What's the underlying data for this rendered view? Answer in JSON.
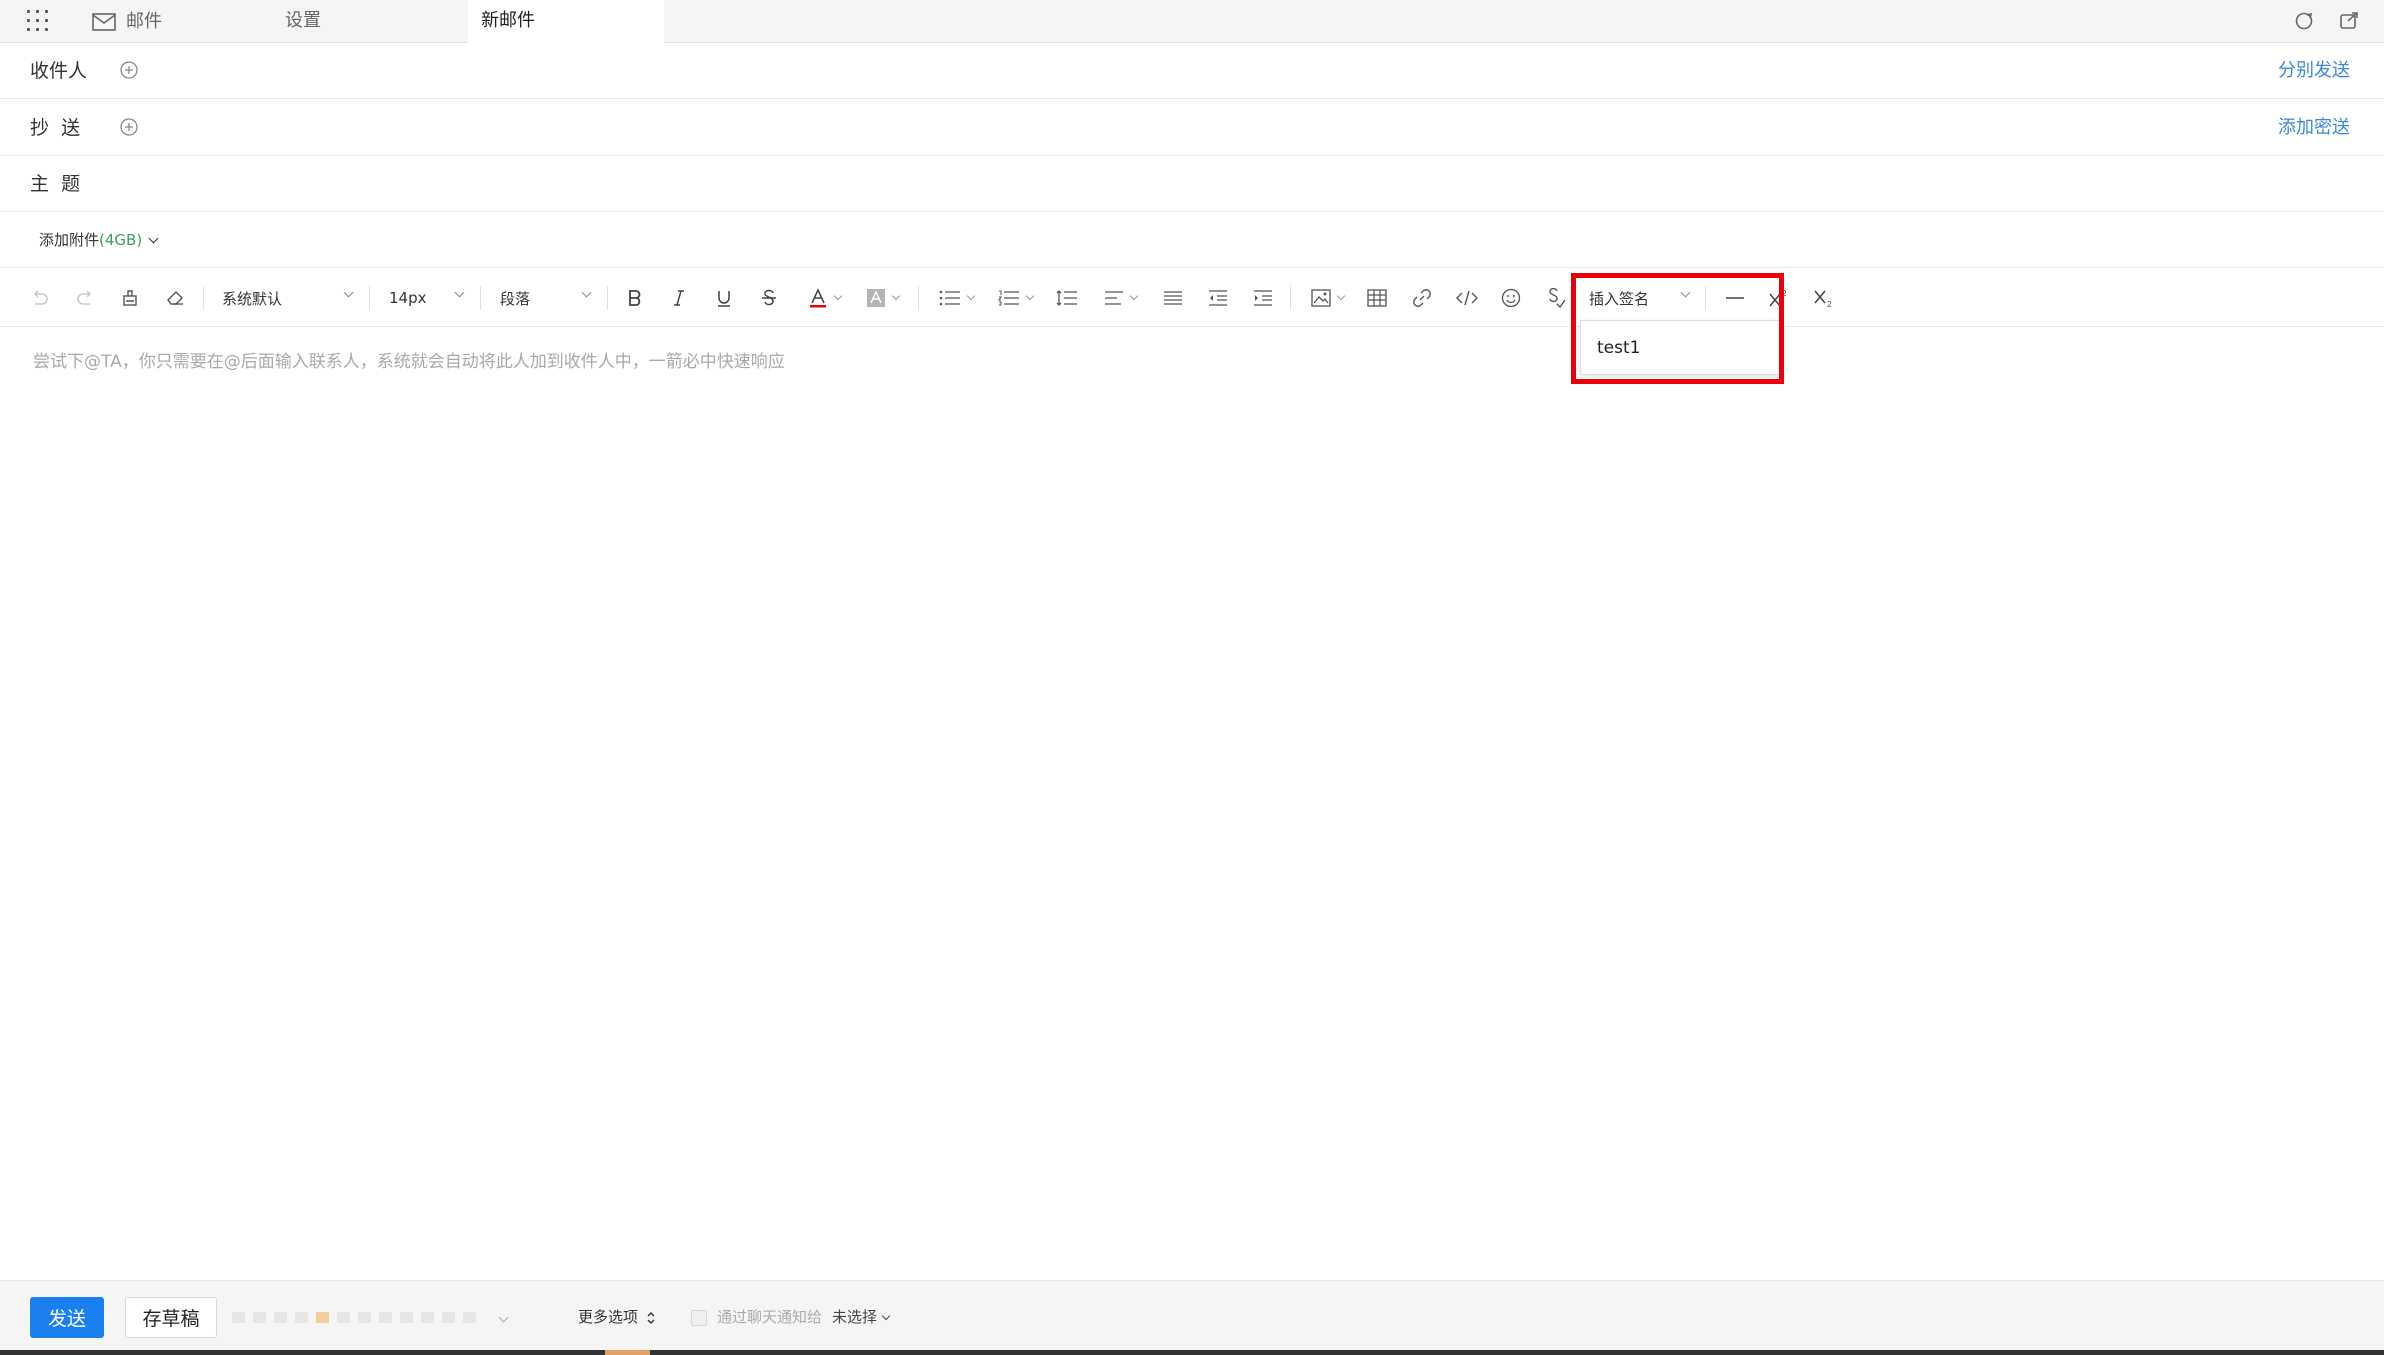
{
  "tabs": {
    "mail": "邮件",
    "settings": "设置",
    "new_mail": "新邮件"
  },
  "header": {
    "to_label": "收件人",
    "to_link": "分别发送",
    "cc_label": "抄  送",
    "cc_link": "添加密送",
    "subject_label": "主  题",
    "attach_label": "添加附件",
    "attach_size": "(4GB)"
  },
  "toolbar": {
    "font_family": "系统默认",
    "font_size": "14px",
    "paragraph": "段落",
    "signature": "插入签名",
    "signature_options": [
      "test1"
    ]
  },
  "editor": {
    "placeholder": "尝试下@TA，你只需要在@后面输入联系人，系统就会自动将此人加到收件人中，一箭必中快速响应"
  },
  "footer": {
    "send": "发送",
    "save_draft": "存草稿",
    "more_options": "更多选项",
    "notify_label": "通过聊天通知给",
    "notify_value": "未选择"
  },
  "icons": [
    "apps-grid-icon",
    "mail-icon",
    "refresh-icon",
    "popout-icon",
    "add-circle-icon",
    "undo-icon",
    "redo-icon",
    "format-painter-icon",
    "eraser-icon",
    "bold-icon",
    "italic-icon",
    "underline-icon",
    "strikethrough-icon",
    "font-color-icon",
    "highlight-icon",
    "bulleted-list-icon",
    "numbered-list-icon",
    "line-height-icon",
    "align-icon",
    "justify-icon",
    "outdent-icon",
    "indent-icon",
    "image-icon",
    "table-icon",
    "link-icon",
    "code-icon",
    "emoji-icon",
    "spellcheck-icon",
    "horizontal-rule-icon",
    "superscript-icon",
    "subscript-icon"
  ],
  "colors": {
    "accent": "#1a80f0",
    "link": "#3a87d8",
    "highlight": "#e8000b",
    "attach_size": "#36a35c"
  }
}
